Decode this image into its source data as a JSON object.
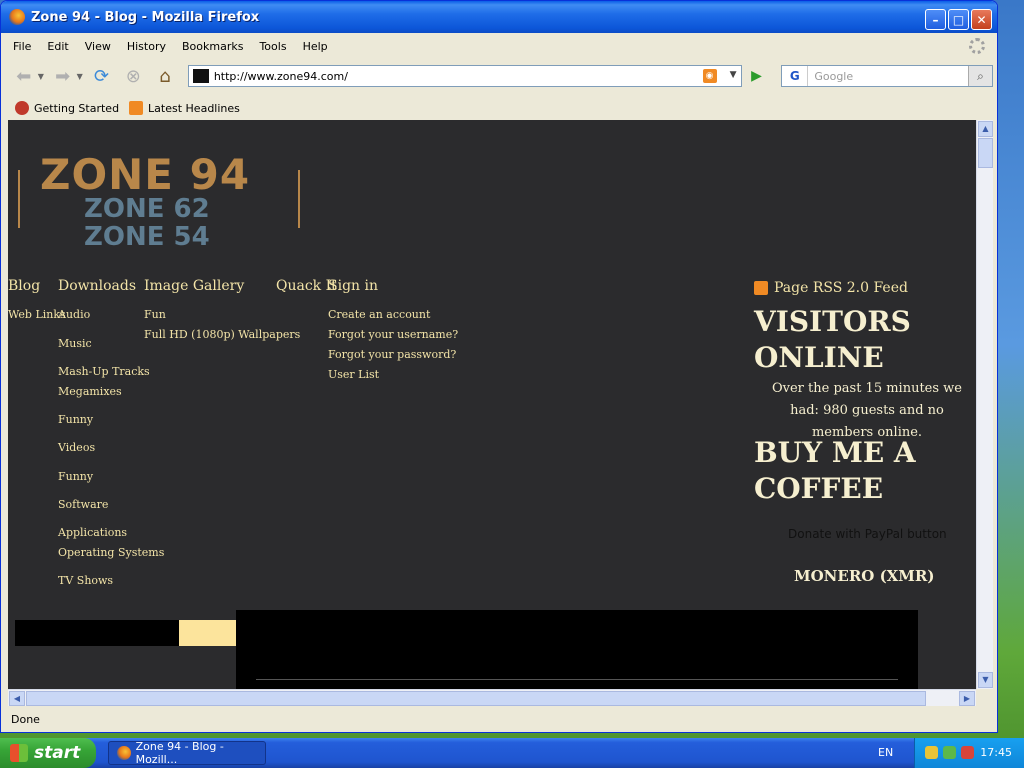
{
  "window": {
    "title": "Zone 94 - Blog - Mozilla Firefox"
  },
  "menu": [
    "File",
    "Edit",
    "View",
    "History",
    "Bookmarks",
    "Tools",
    "Help"
  ],
  "address": {
    "url": "http://www.zone94.com/"
  },
  "search": {
    "engine": "G",
    "placeholder": "Google"
  },
  "bookmarks": [
    "Getting Started",
    "Latest Headlines"
  ],
  "page": {
    "logo": {
      "line1": "ZONE 94",
      "line2": "ZONE 62",
      "line3": "ZONE 54"
    },
    "nav": {
      "blog": "Blog",
      "downloads": "Downloads",
      "gallery": "Image Gallery",
      "quickit": "Quack It",
      "signin": "Sign in"
    },
    "sub": {
      "weblinks": "Web Links",
      "audio": "Audio",
      "music": "Music",
      "mashup": "Mash-Up Tracks",
      "megamixes": "Megamixes",
      "funny1": "Funny",
      "videos": "Videos",
      "funny2": "Funny",
      "software": "Software",
      "applications": "Applications",
      "os": "Operating Systems",
      "tvshows": "TV Shows",
      "fun": "Fun",
      "wallpapers": "Full HD (1080p) Wallpapers",
      "create": "Create an account",
      "forgot_user": "Forgot your username?",
      "forgot_pass": "Forgot your password?",
      "userlist": "User List"
    },
    "sidebar": {
      "rss": "Page RSS 2.0 Feed",
      "visitors_h1": "VISITORS",
      "visitors_h2": "ONLINE",
      "visitors_text": "Over the past 15 minutes we had: 980 guests and no members online.",
      "coffee_h1": "BUY ME A",
      "coffee_h2": "COFFEE",
      "paypal": "Donate with PayPal button",
      "monero": "MONERO (XMR)"
    }
  },
  "status": "Done",
  "taskbar": {
    "start": "start",
    "item": "Zone 94 - Blog - Mozill...",
    "lang": "EN",
    "clock": "17:45"
  }
}
